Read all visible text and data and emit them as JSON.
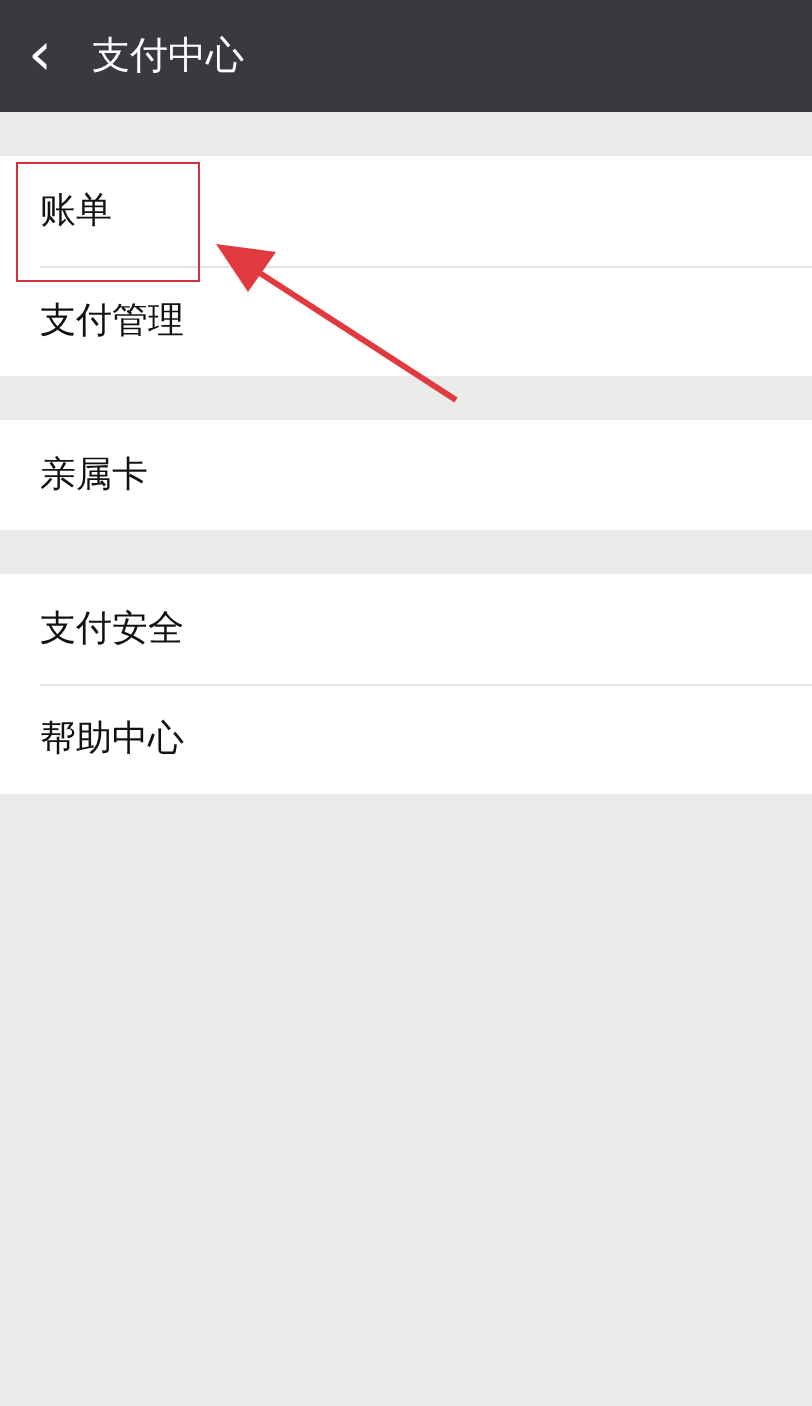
{
  "header": {
    "back": "‹",
    "title": "支付中心"
  },
  "groups": [
    {
      "items": [
        {
          "label": "账单",
          "highlighted": true
        },
        {
          "label": "支付管理",
          "highlighted": false
        }
      ]
    },
    {
      "items": [
        {
          "label": "亲属卡",
          "highlighted": false
        }
      ]
    },
    {
      "items": [
        {
          "label": "支付安全",
          "highlighted": false
        },
        {
          "label": "帮助中心",
          "highlighted": false
        }
      ]
    }
  ]
}
